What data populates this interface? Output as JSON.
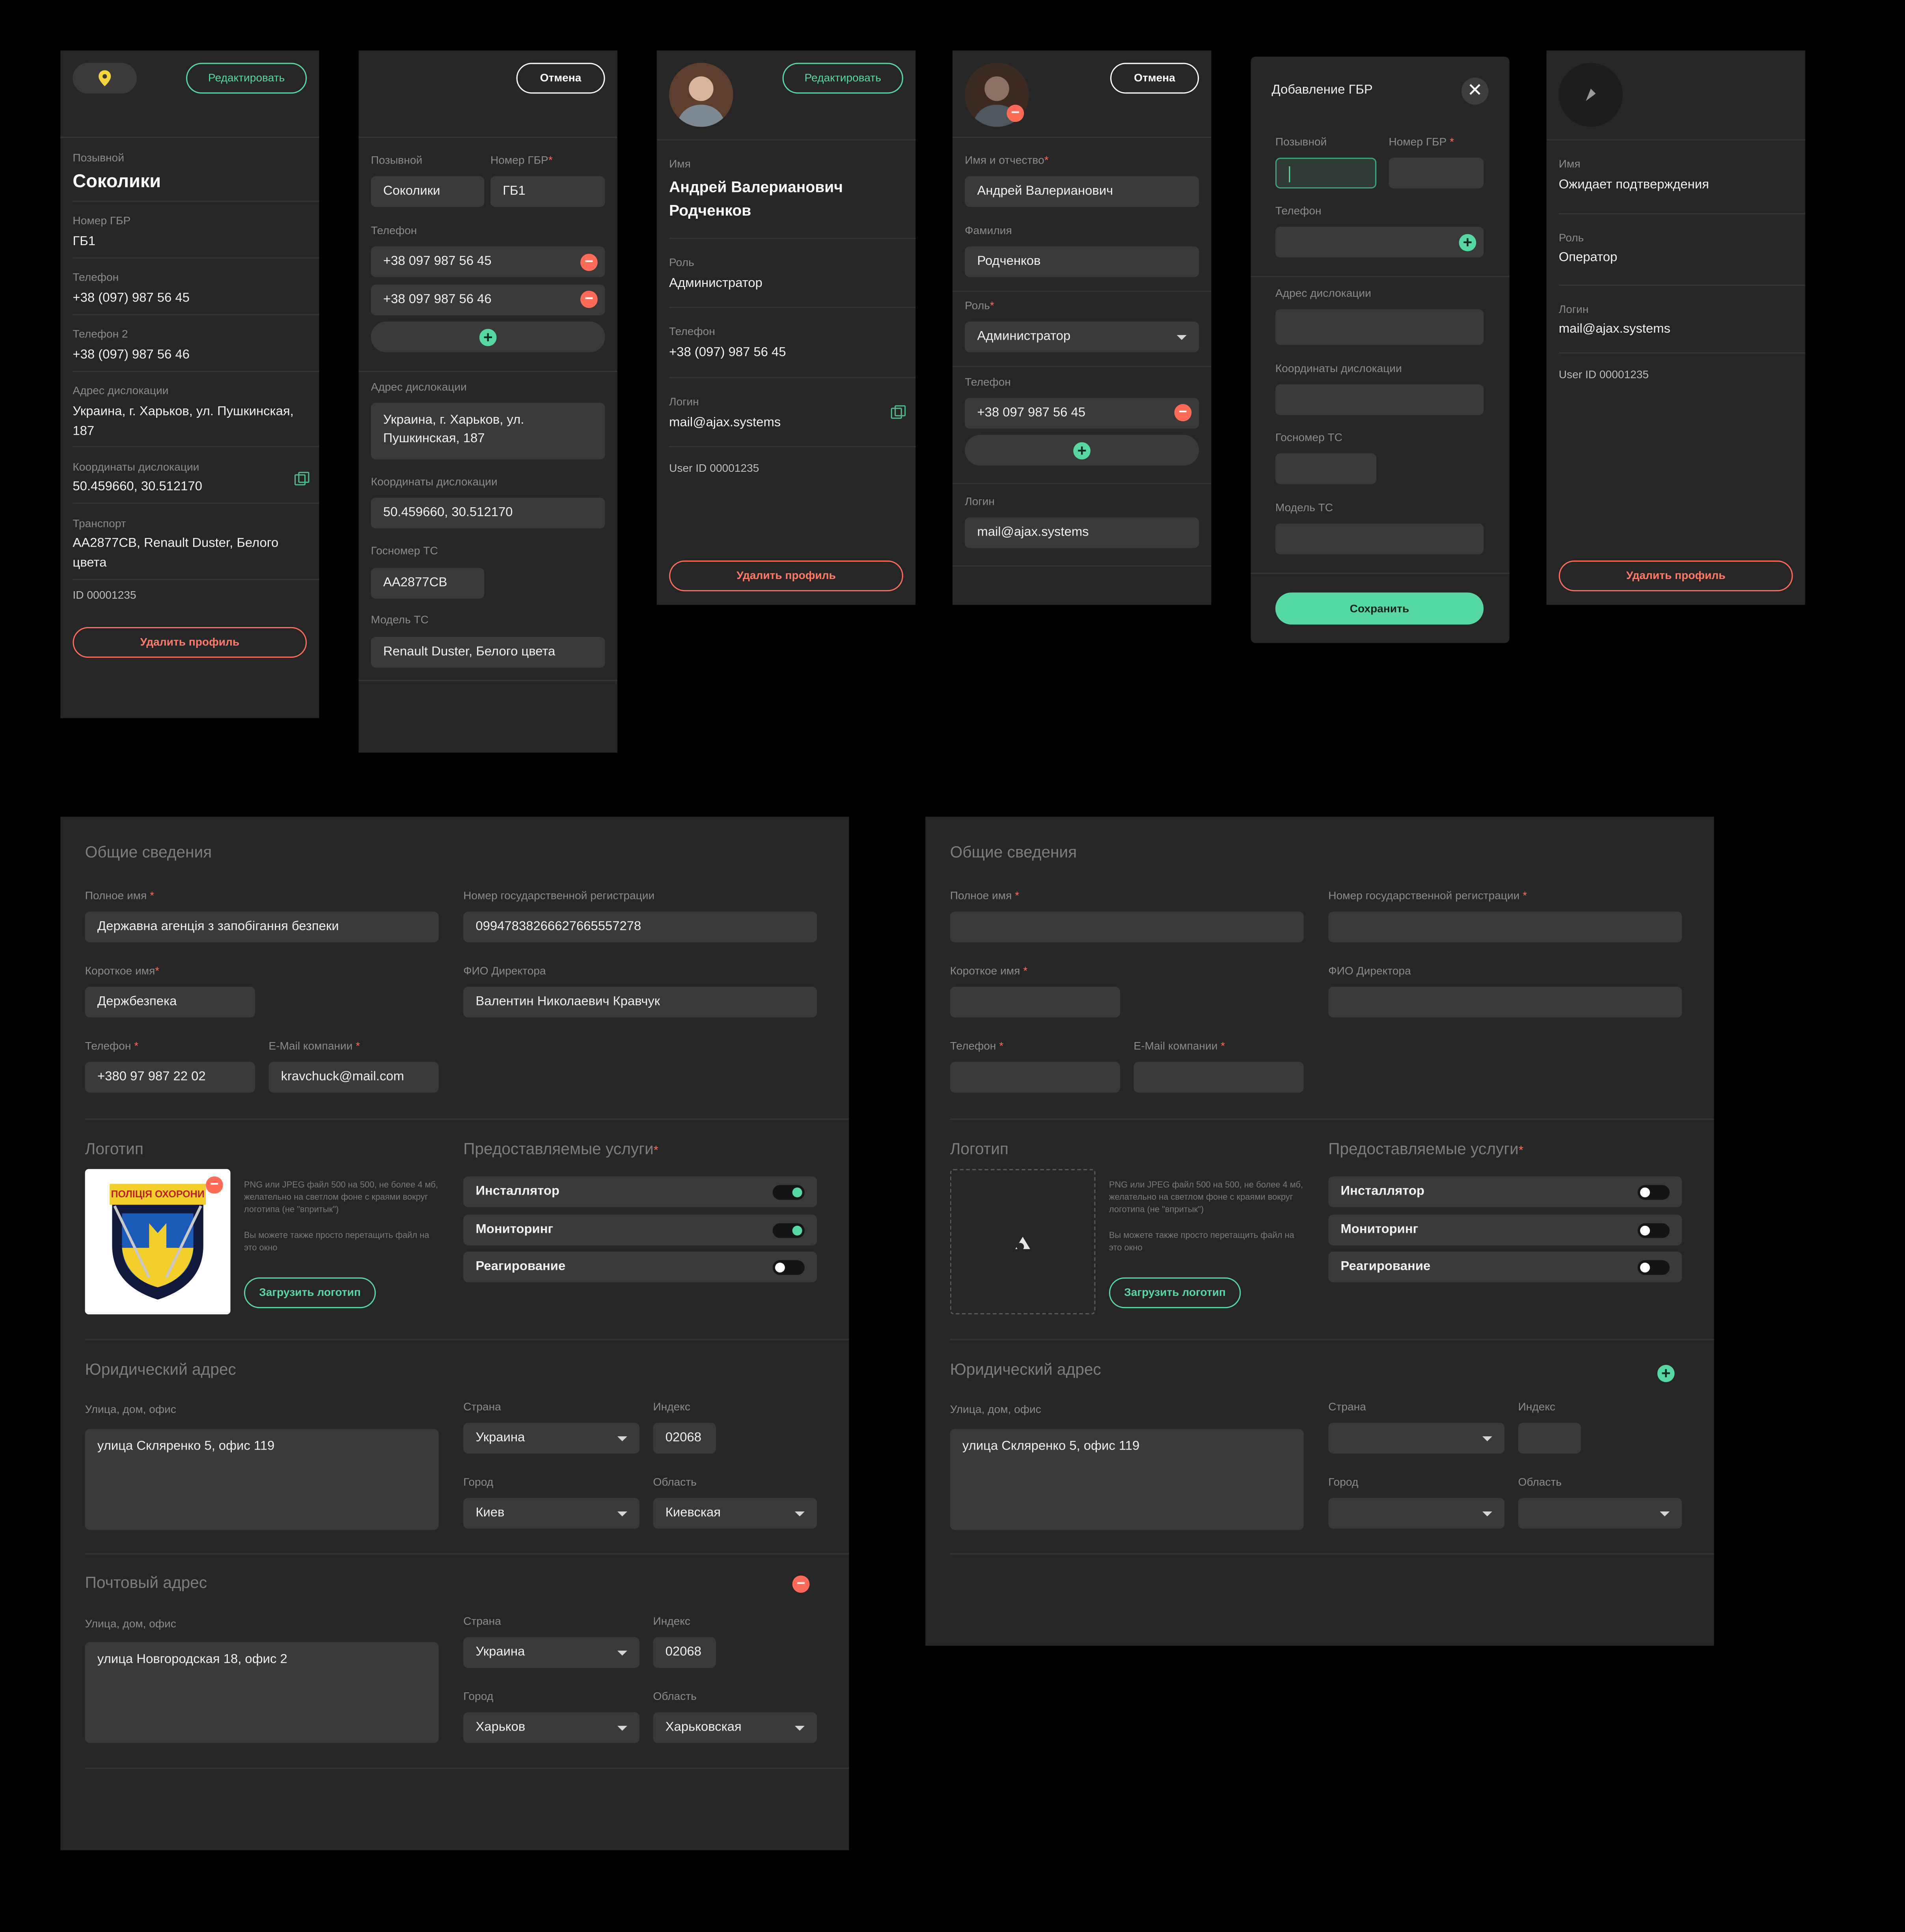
{
  "colors": {
    "accent": "#56d8a2",
    "danger": "#ff6b57",
    "card": "#262626",
    "input": "#3a3a3a"
  },
  "p1": {
    "edit": "Редактировать",
    "callsign_label": "Позывной",
    "callsign": "Соколики",
    "gbr_label": "Номер ГБР",
    "gbr": "ГБ1",
    "phone_label": "Телефон",
    "phone": "+38 (097) 987 56 45",
    "phone2_label": "Телефон 2",
    "phone2": "+38 (097) 987 56 46",
    "addr_label": "Адрес дислокации",
    "addr": "Украина, г. Харьков, ул. Пушкинская, 187",
    "coords_label": "Координаты дислокации",
    "coords": "50.459660, 30.512170",
    "transport_label": "Транспорт",
    "transport": "AA2877CB, Renault Duster, Белого цвета",
    "id": "ID 00001235",
    "delete": "Удалить профиль"
  },
  "p2": {
    "cancel": "Отмена",
    "callsign_label": "Позывной",
    "gbr_label": "Номер ГБР",
    "callsign": "Соколики",
    "gbr": "ГБ1",
    "phone_label": "Телефон",
    "phone1": "+38 097 987 56 45",
    "phone2": "+38 097 987 56 46",
    "addr_label": "Адрес дислокации",
    "addr": "Украина, г. Харьков, ул. Пушкинская, 187",
    "coords_label": "Координаты дислокации",
    "coords": "50.459660, 30.512170",
    "plate_label": "Госномер ТС",
    "plate": "AA2877CB",
    "model_label": "Модель ТС",
    "model": "Renault Duster, Белого цвета"
  },
  "p3": {
    "edit": "Редактировать",
    "name_label": "Имя",
    "name": "Андрей Валерианович Родченков",
    "role_label": "Роль",
    "role": "Администратор",
    "phone_label": "Телефон",
    "phone": "+38 (097) 987 56 45",
    "login_label": "Логин",
    "login": "mail@ajax.systems",
    "uid": "User ID 00001235",
    "delete": "Удалить профиль"
  },
  "p4": {
    "cancel": "Отмена",
    "first_label": "Имя и отчество",
    "first": "Андрей Валерианович",
    "last_label": "Фамилия",
    "last": "Родченков",
    "role_label": "Роль",
    "role": "Администратор",
    "phone_label": "Телефон",
    "phone": "+38 097 987 56 45",
    "login_label": "Логин",
    "login": "mail@ajax.systems"
  },
  "p5": {
    "title": "Добавление ГБР",
    "callsign_label": "Позывной",
    "gbr_label": "Номер ГБР",
    "phone_label": "Телефон",
    "addr_label": "Адрес дислокации",
    "coords_label": "Координаты дислокации",
    "plate_label": "Госномер ТС",
    "model_label": "Модель ТС",
    "save": "Сохранить"
  },
  "p6": {
    "name_label": "Имя",
    "name": "Ожидает подтверждения",
    "role_label": "Роль",
    "role": "Оператор",
    "login_label": "Логин",
    "login": "mail@ajax.systems",
    "uid": "User ID 00001235",
    "delete": "Удалить профиль"
  },
  "c1": {
    "general": "Общие сведения",
    "fullname_label": "Полное имя",
    "fullname": "Державна агенція з запобігання безпеки",
    "reg_label": "Номер государственной регистрации",
    "reg": "09947838266627665557278",
    "short_label": "Короткое имя",
    "short": "Держбезпека",
    "director_label": "ФИО Директора",
    "director": "Валентин Николаевич Кравчук",
    "phone_label": "Телефон",
    "phone": "+380 97 987 22 02",
    "email_label": "E-Mail компании",
    "email": "kravchuck@mail.com",
    "logo": "Логотип",
    "logo_badge": "ПОЛІЦІЯ ОХОРОНИ",
    "logo_hint": "PNG или JPEG файл 500 на 500, не более 4 мб, желательно на светлом фоне с краями вокруг логотипа (не \"впритык\")",
    "logo_hint2": "Вы можете также просто перетащить файл на это окно",
    "upload": "Загрузить логотип",
    "services": "Предоставляемые услуги",
    "svc1": "Инсталлятор",
    "svc2": "Мониторинг",
    "svc3": "Реагирование",
    "legal": "Юридический адрес",
    "street_label": "Улица, дом, офис",
    "street": "улица Скляренко 5, офис 119",
    "country_label": "Страна",
    "country": "Украина",
    "index_label": "Индекс",
    "index": "02068",
    "city_label": "Город",
    "city": "Киев",
    "region_label": "Область",
    "region": "Киевская",
    "postal": "Почтовый адрес",
    "pstreet": "улица Новгородская 18, офис 2",
    "pcountry": "Украина",
    "pindex": "02068",
    "pcity": "Харьков",
    "pregion": "Харьковская"
  },
  "c2": {
    "general": "Общие сведения",
    "fullname_label": "Полное имя",
    "reg_label": "Номер государственной регистрации",
    "short_label": "Короткое имя",
    "director_label": "ФИО Директора",
    "phone_label": "Телефон",
    "email_label": "E-Mail компании",
    "logo": "Логотип",
    "logo_hint": "PNG или JPEG файл 500 на 500, не более 4 мб, желательно на светлом фоне с краями вокруг логотипа (не \"впритык\")",
    "logo_hint2": "Вы можете также просто перетащить файл на это окно",
    "upload": "Загрузить логотип",
    "services": "Предоставляемые услуги",
    "svc1": "Инсталлятор",
    "svc2": "Мониторинг",
    "svc3": "Реагирование",
    "legal": "Юридический адрес",
    "street_label": "Улица, дом, офис",
    "street": "улица Скляренко 5, офис 119",
    "country_label": "Страна",
    "index_label": "Индекс",
    "city_label": "Город",
    "region_label": "Область"
  },
  "req": "*"
}
